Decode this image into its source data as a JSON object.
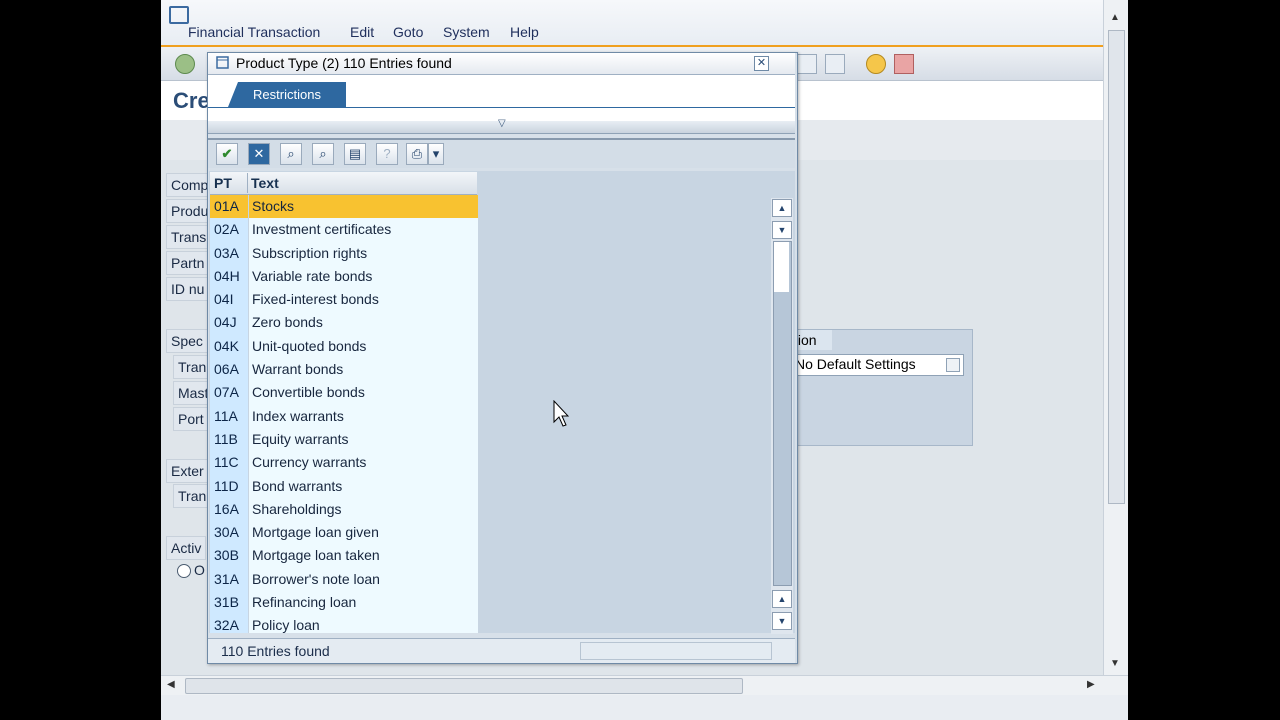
{
  "menu": [
    "Financial Transaction",
    "Edit",
    "Goto",
    "System",
    "Help"
  ],
  "app_title": "Cre",
  "field_labels": [
    "Comp",
    "Produ",
    "Trans",
    "Partn",
    "ID nu",
    "Spec",
    "Tran",
    "Mast",
    "Port",
    "Exter",
    "Tran",
    "Activ"
  ],
  "radio_label": "O",
  "right_panel": {
    "header_fragment": "tion",
    "dropdown_value": "No Default Settings"
  },
  "popup": {
    "title": "Product Type (2)  110 Entries found",
    "tab": "Restrictions",
    "columns": {
      "code": "PT",
      "text": "Text"
    },
    "footer": "110 Entries found",
    "rows": [
      {
        "code": "01A",
        "text": "Stocks",
        "selected": true
      },
      {
        "code": "02A",
        "text": "Investment certificates"
      },
      {
        "code": "03A",
        "text": "Subscription rights"
      },
      {
        "code": "04H",
        "text": "Variable rate bonds"
      },
      {
        "code": "04I",
        "text": "Fixed-interest bonds"
      },
      {
        "code": "04J",
        "text": "Zero bonds"
      },
      {
        "code": "04K",
        "text": "Unit-quoted bonds"
      },
      {
        "code": "06A",
        "text": "Warrant bonds"
      },
      {
        "code": "07A",
        "text": "Convertible bonds"
      },
      {
        "code": "11A",
        "text": "Index warrants"
      },
      {
        "code": "11B",
        "text": "Equity warrants"
      },
      {
        "code": "11C",
        "text": "Currency warrants"
      },
      {
        "code": "11D",
        "text": "Bond warrants"
      },
      {
        "code": "16A",
        "text": "Shareholdings"
      },
      {
        "code": "30A",
        "text": "Mortgage loan given"
      },
      {
        "code": "30B",
        "text": "Mortgage loan taken"
      },
      {
        "code": "31A",
        "text": "Borrower's note loan"
      },
      {
        "code": "31B",
        "text": "Refinancing loan"
      },
      {
        "code": "32A",
        "text": "Policy loan"
      }
    ]
  },
  "icons": {
    "toolbar": [
      "enter-icon",
      "cancel-icon",
      "find-icon",
      "find-next-icon",
      "settings-icon",
      "help-icon",
      "print-icon",
      "menu-icon"
    ]
  }
}
